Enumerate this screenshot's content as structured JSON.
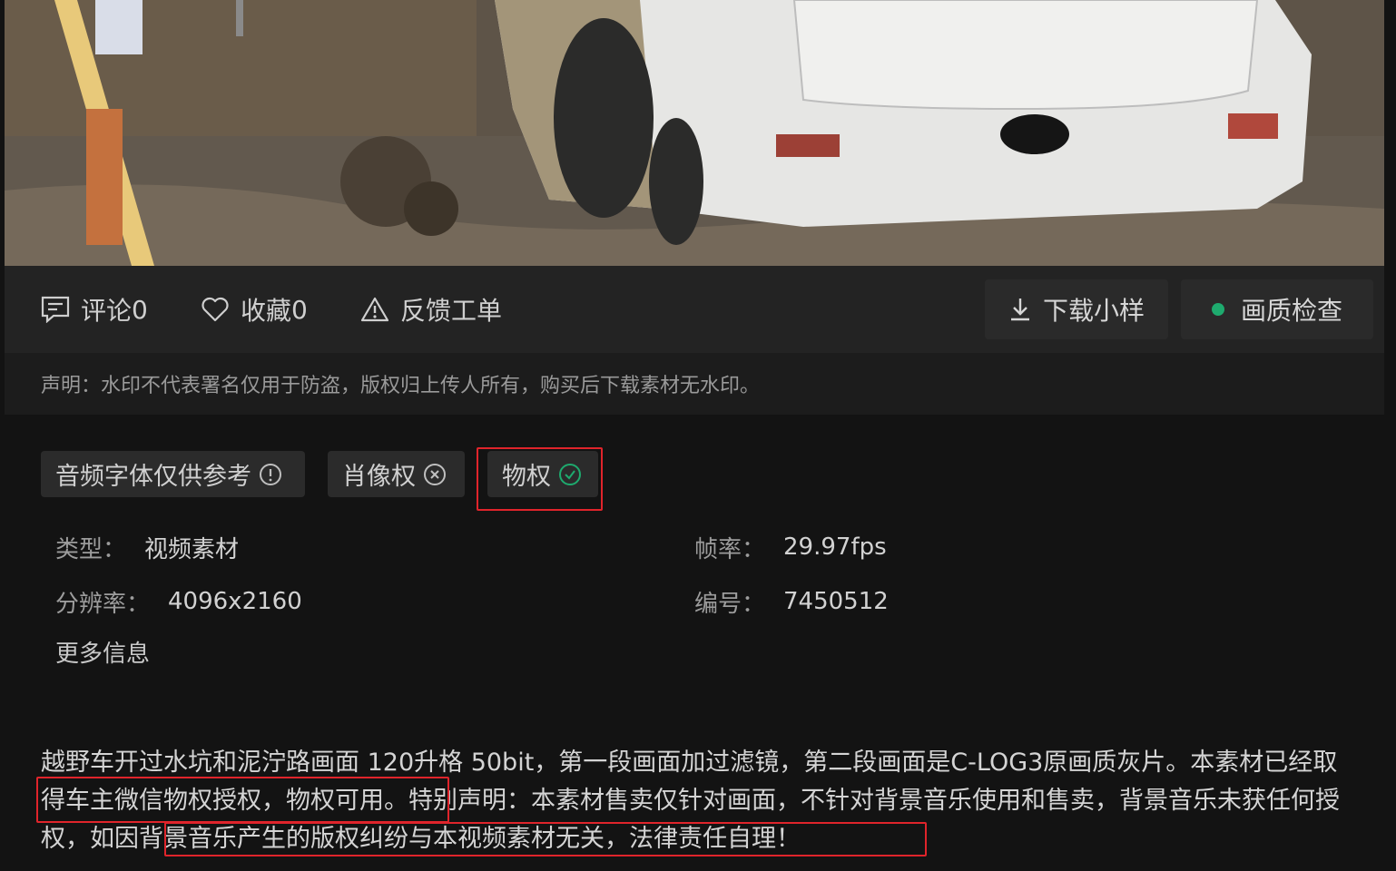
{
  "actions": {
    "comment_label": "评论",
    "comment_count": "0",
    "favorite_label": "收藏",
    "favorite_count": "0",
    "feedback_label": "反馈工单",
    "download_label": "下载小样",
    "quality_label": "画质检查",
    "quality_status_color": "#1eaa6e"
  },
  "disclaimer": "声明：水印不代表署名仅用于防盗，版权归上传人所有，购买后下载素材无水印。",
  "tags": [
    {
      "label": "音频字体仅供参考",
      "icon": "info-icon",
      "color": "#bfbfbf"
    },
    {
      "label": "肖像权",
      "icon": "x-circle-icon",
      "color": "#bfbfbf"
    },
    {
      "label": "物权",
      "icon": "check-circle-icon",
      "color": "#1eaa6e"
    }
  ],
  "info": {
    "type_label": "类型：",
    "type_value": "视频素材",
    "fps_label": "帧率：",
    "fps_value": "29.97fps",
    "resolution_label": "分辨率：",
    "resolution_value": "4096x2160",
    "id_label": "编号：",
    "id_value": "7450512",
    "more_label": "更多信息"
  },
  "description": {
    "part1": "越野车开过水坑和泥泞路画面 120升格 50bit，第一段画面加过滤镜，第二段画面是C-LOG3原画质灰片。本素材已经",
    "part2": "取得车主微信物权授权，物权可用。",
    "part3": "特别声明：本素材售卖仅针对画面，不针对背景音乐使用和售卖，背景音乐未获任何授权，",
    "part4": "如因背景音乐产生的版权纠纷与本视频素材无关，法律责任自理！"
  },
  "highlight_color": "#e0242b"
}
